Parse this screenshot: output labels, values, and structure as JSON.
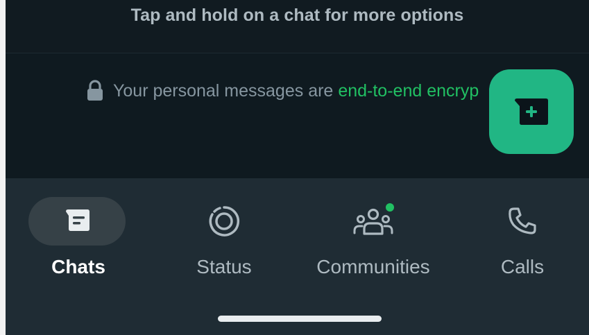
{
  "hint": {
    "text": "Tap and hold on a chat for more options"
  },
  "encryption": {
    "prefix": "Your personal messages are",
    "link": "end-to-end encryp",
    "lock_icon": "lock-icon"
  },
  "fab": {
    "icon": "new-chat-icon",
    "color": "#21b684"
  },
  "nav": {
    "items": [
      {
        "label": "Chats",
        "icon": "chats-icon",
        "active": true
      },
      {
        "label": "Status",
        "icon": "status-icon",
        "active": false
      },
      {
        "label": "Communities",
        "icon": "communities-icon",
        "active": false
      },
      {
        "label": "Calls",
        "icon": "calls-icon",
        "active": false
      }
    ]
  },
  "colors": {
    "background": "#0b141a",
    "accent": "#21c063",
    "nav_background": "#1f2c34",
    "active_pill": "#364147"
  }
}
